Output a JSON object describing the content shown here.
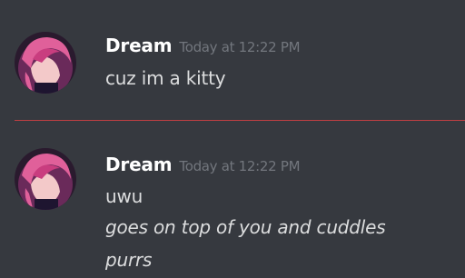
{
  "messages": [
    {
      "username": "Dream",
      "timestamp": "Today at 12:22 PM",
      "lines": [
        "cuz im a kitty"
      ]
    },
    {
      "username": "Dream",
      "timestamp": "Today at 12:22 PM",
      "lines": [
        "uwu",
        "goes on top of you and cuddles",
        "purrs"
      ]
    }
  ],
  "colors": {
    "background": "#36393f",
    "username": "#ffffff",
    "timestamp": "#72767d",
    "message_text": "#dcddde",
    "new_messages_divider": "#ed4245"
  },
  "icons": [
    "user-avatar"
  ]
}
